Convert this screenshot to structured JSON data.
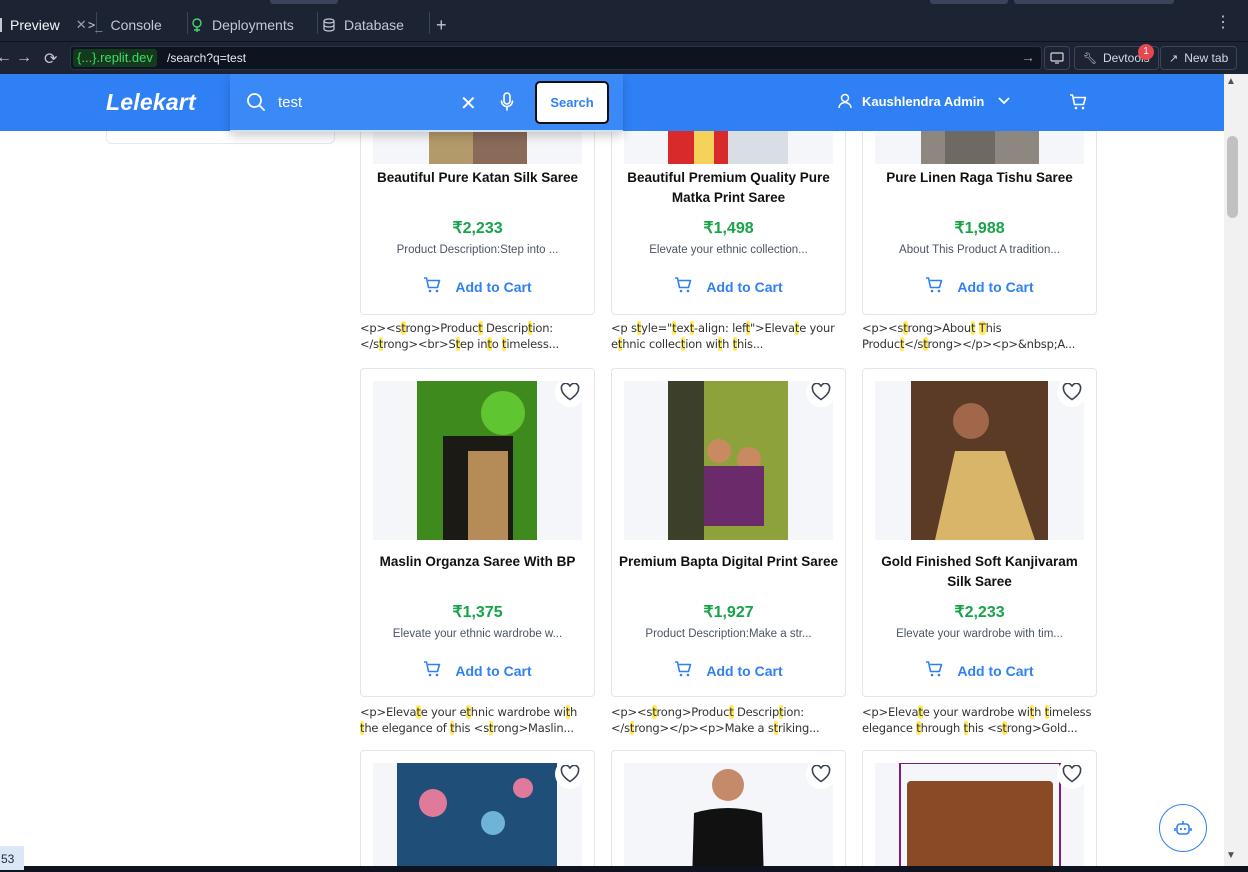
{
  "ide": {
    "tabs": [
      {
        "label": "Preview",
        "active": true
      },
      {
        "label": "Console",
        "active": false
      },
      {
        "label": "Deployments",
        "active": false
      },
      {
        "label": "Database",
        "active": false
      }
    ],
    "new_tab_symbol": "+",
    "url_domain": "{...}.replit.dev",
    "url_path": "/search?q=test",
    "devtools_label": "Devtools",
    "devtools_badge": "1",
    "new_tab_label": "New tab",
    "corner_number": "53"
  },
  "app": {
    "logo": "Lelekart",
    "search_value": "test",
    "search_button": "Search",
    "user_name": "Kaushlendra Admin",
    "colors": {
      "primary": "#2f80f5",
      "price": "#16a34a",
      "highlight": "#ffea5c"
    }
  },
  "products": [
    {
      "name": "Beautiful Pure Katan Silk Saree",
      "price": "₹2,233",
      "desc": "Product Description:Step into ...",
      "cta": "Add to Cart",
      "raw": [
        [
          "<p><s",
          ""
        ],
        [
          "t",
          "hl"
        ],
        [
          "rong>Produc",
          ""
        ],
        [
          "t",
          "hl"
        ],
        [
          " Descrip",
          ""
        ],
        [
          "t",
          "hl"
        ],
        [
          "ion:",
          ""
        ],
        [
          "\n</s",
          ""
        ],
        [
          "t",
          "hl"
        ],
        [
          "rong><br>S",
          ""
        ],
        [
          "t",
          "hl"
        ],
        [
          "ep in",
          ""
        ],
        [
          "t",
          "hl"
        ],
        [
          "o ",
          ""
        ],
        [
          "t",
          "hl"
        ],
        [
          "imeless...",
          ""
        ]
      ]
    },
    {
      "name": "Beautiful Premium Quality Pure Matka Print Saree",
      "price": "₹1,498",
      "desc": "Elevate your ethnic collection...",
      "cta": "Add to Cart",
      "raw": [
        [
          "<p s",
          ""
        ],
        [
          "t",
          "hl"
        ],
        [
          "yle=\"",
          ""
        ],
        [
          "t",
          "hl"
        ],
        [
          "ex",
          ""
        ],
        [
          "t",
          "hl"
        ],
        [
          "-align: lef",
          ""
        ],
        [
          "t",
          "hl"
        ],
        [
          "\">Eleva",
          ""
        ],
        [
          "t",
          "hl"
        ],
        [
          "e your",
          ""
        ],
        [
          "\ne",
          ""
        ],
        [
          "t",
          "hl"
        ],
        [
          "hnic collec",
          ""
        ],
        [
          "t",
          "hl"
        ],
        [
          "ion wi",
          ""
        ],
        [
          "t",
          "hl"
        ],
        [
          "h ",
          ""
        ],
        [
          "t",
          "hl"
        ],
        [
          "his...",
          ""
        ]
      ]
    },
    {
      "name": "Pure Linen Raga Tishu Saree",
      "price": "₹1,988",
      "desc": "About This Product A tradition...",
      "cta": "Add to Cart",
      "raw": [
        [
          "<p><s",
          ""
        ],
        [
          "t",
          "hl"
        ],
        [
          "rong>Abou",
          ""
        ],
        [
          "t",
          "hl"
        ],
        [
          " ",
          ""
        ],
        [
          "T",
          "hl"
        ],
        [
          "his",
          ""
        ],
        [
          "\nProduc",
          ""
        ],
        [
          "t",
          "hl"
        ],
        [
          "</s",
          ""
        ],
        [
          "t",
          "hl"
        ],
        [
          "rong></p><p>&nbsp;A...",
          ""
        ]
      ]
    },
    {
      "name": "Maslin Organza Saree With BP",
      "price": "₹1,375",
      "desc": "Elevate your ethnic wardrobe w...",
      "cta": "Add to Cart",
      "raw": [
        [
          "<p>Eleva",
          ""
        ],
        [
          "t",
          "hl"
        ],
        [
          "e your e",
          ""
        ],
        [
          "t",
          "hl"
        ],
        [
          "hnic wardrobe wi",
          ""
        ],
        [
          "t",
          "hl"
        ],
        [
          "h",
          ""
        ],
        [
          "\n",
          ""
        ],
        [
          "t",
          "hl"
        ],
        [
          "he elegance of ",
          ""
        ],
        [
          "t",
          "hl"
        ],
        [
          "his <s",
          ""
        ],
        [
          "t",
          "hl"
        ],
        [
          "rong>Maslin...",
          ""
        ]
      ]
    },
    {
      "name": "Premium Bapta Digital Print Saree",
      "price": "₹1,927",
      "desc": "Product Description:Make a str...",
      "cta": "Add to Cart",
      "raw": [
        [
          "<p><s",
          ""
        ],
        [
          "t",
          "hl"
        ],
        [
          "rong>Produc",
          ""
        ],
        [
          "t",
          "hl"
        ],
        [
          " Descrip",
          ""
        ],
        [
          "t",
          "hl"
        ],
        [
          "ion:",
          ""
        ],
        [
          "\n</s",
          ""
        ],
        [
          "t",
          "hl"
        ],
        [
          "rong></p><p>Make a s",
          ""
        ],
        [
          "t",
          "hl"
        ],
        [
          "riking...",
          ""
        ]
      ]
    },
    {
      "name": "Gold Finished Soft Kanjivaram Silk Saree",
      "price": "₹2,233",
      "desc": "Elevate your wardrobe with tim...",
      "cta": "Add to Cart",
      "raw": [
        [
          "<p>Eleva",
          ""
        ],
        [
          "t",
          "hl"
        ],
        [
          "e your wardrobe wi",
          ""
        ],
        [
          "t",
          "hl"
        ],
        [
          "h ",
          ""
        ],
        [
          "t",
          "hl"
        ],
        [
          "imeless",
          ""
        ],
        [
          "\nelegance ",
          ""
        ],
        [
          "t",
          "hl"
        ],
        [
          "hrough ",
          ""
        ],
        [
          "t",
          "hl"
        ],
        [
          "his <s",
          ""
        ],
        [
          "t",
          "hl"
        ],
        [
          "rong>Gold...",
          ""
        ]
      ]
    }
  ]
}
